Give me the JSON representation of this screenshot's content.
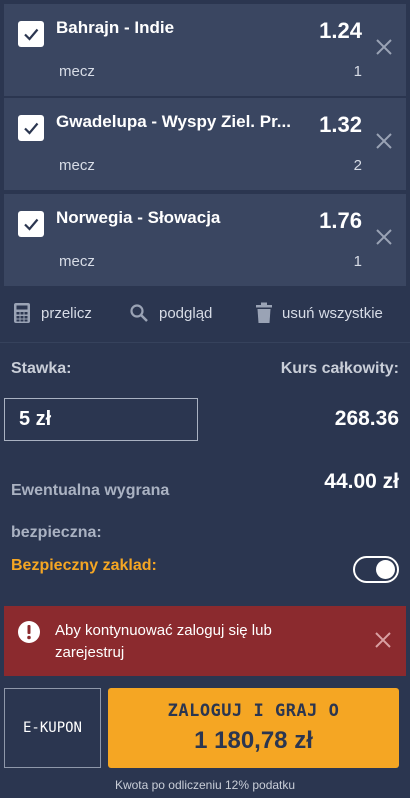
{
  "bets": [
    {
      "name": "Bahrajn - Indie",
      "odd": "1.24",
      "type": "mecz",
      "pick": "1",
      "checked": true
    },
    {
      "name": "Gwadelupa - Wyspy Ziel. Pr...",
      "odd": "1.32",
      "type": "mecz",
      "pick": "2",
      "checked": true
    },
    {
      "name": "Norwegia - Słowacja",
      "odd": "1.76",
      "type": "mecz",
      "pick": "1",
      "checked": true
    }
  ],
  "actions": {
    "recalc": "przelicz",
    "preview": "podgląd",
    "remove_all": "usuń wszystkie"
  },
  "stake": {
    "label": "Stawka:",
    "value": "5 zł"
  },
  "total": {
    "label": "Kurs całkowity:",
    "value": "268.36"
  },
  "win": {
    "label": "Ewentualna wygrana bezpieczna:",
    "value": "44.00 zł"
  },
  "safe_bet": {
    "label": "Bezpieczny zaklad:",
    "enabled": true
  },
  "alert": {
    "message": "Aby kontynuować zaloguj się lub zarejestruj"
  },
  "buttons": {
    "ekupon": "E-KUPON",
    "login_line1": "ZALOGUJ I GRAJ O",
    "login_line2": "1 180,78 zł"
  },
  "tax_note": "Kwota po odliczeniu 12% podatku",
  "colors": {
    "background": "#2b3650",
    "card": "#3a4661",
    "accent": "#f5a623",
    "alert": "#8b2a2e"
  }
}
